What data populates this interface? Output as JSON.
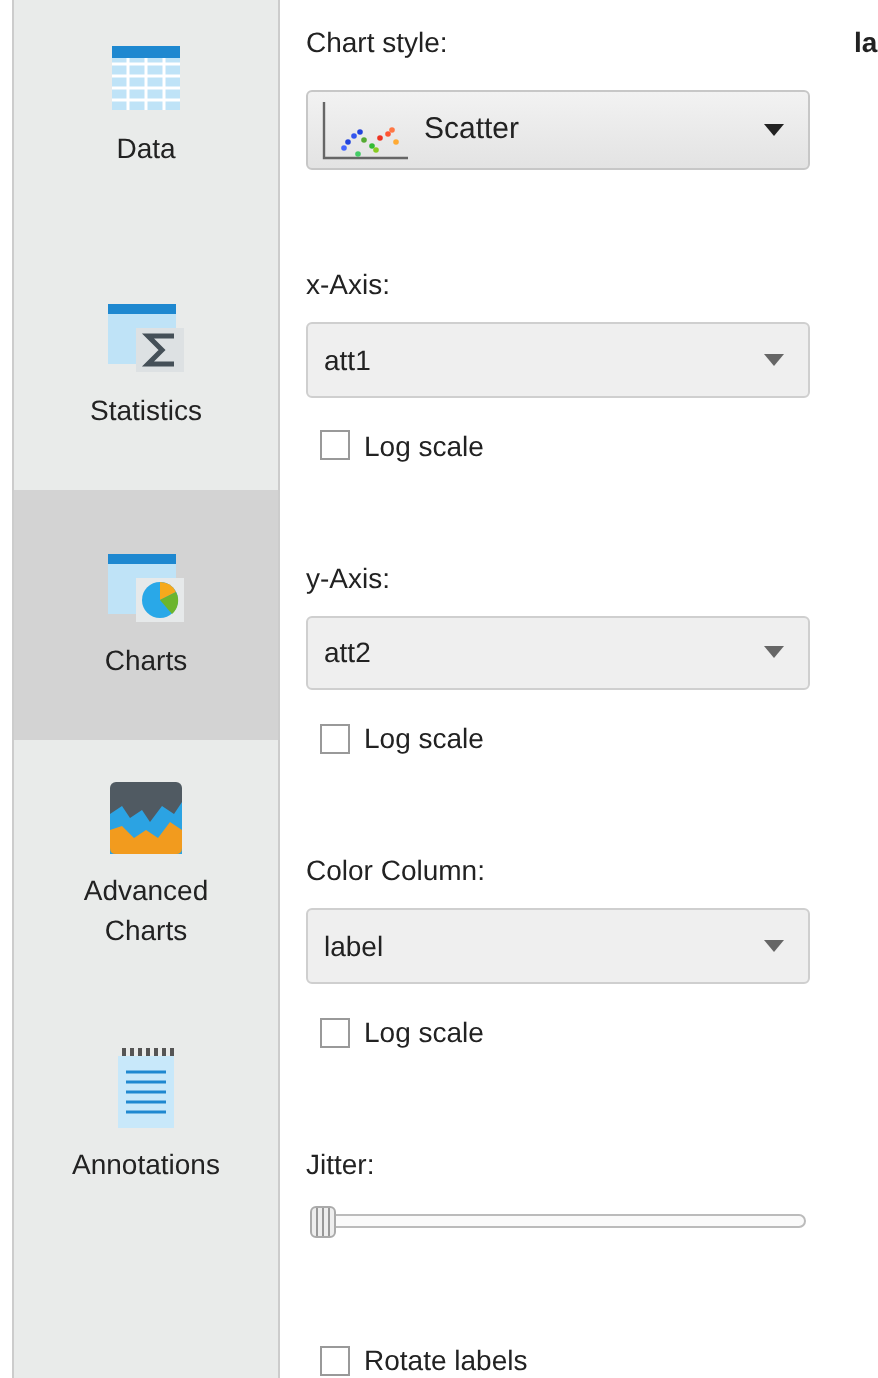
{
  "sidebar": {
    "items": [
      {
        "kind": "data",
        "label": "Data",
        "selected": false
      },
      {
        "kind": "statistics",
        "label": "Statistics",
        "selected": false
      },
      {
        "kind": "charts",
        "label": "Charts",
        "selected": true
      },
      {
        "kind": "advanced",
        "label": "Advanced Charts",
        "selected": false
      },
      {
        "kind": "annotations",
        "label": "Annotations",
        "selected": false
      }
    ]
  },
  "chart_style": {
    "label": "Chart style:",
    "value": "Scatter"
  },
  "side_heading": "la",
  "selects": [
    {
      "label": "x-Axis:",
      "value": "att1",
      "log_scale": {
        "label": "Log scale",
        "checked": false
      }
    },
    {
      "label": "y-Axis:",
      "value": "att2",
      "log_scale": {
        "label": "Log scale",
        "checked": false
      }
    },
    {
      "label": "Color Column:",
      "value": "label",
      "log_scale": {
        "label": "Log scale",
        "checked": false
      }
    }
  ],
  "jitter": {
    "label": "Jitter:",
    "level": 0
  },
  "rotate_labels": {
    "label": "Rotate labels",
    "checked": false
  }
}
